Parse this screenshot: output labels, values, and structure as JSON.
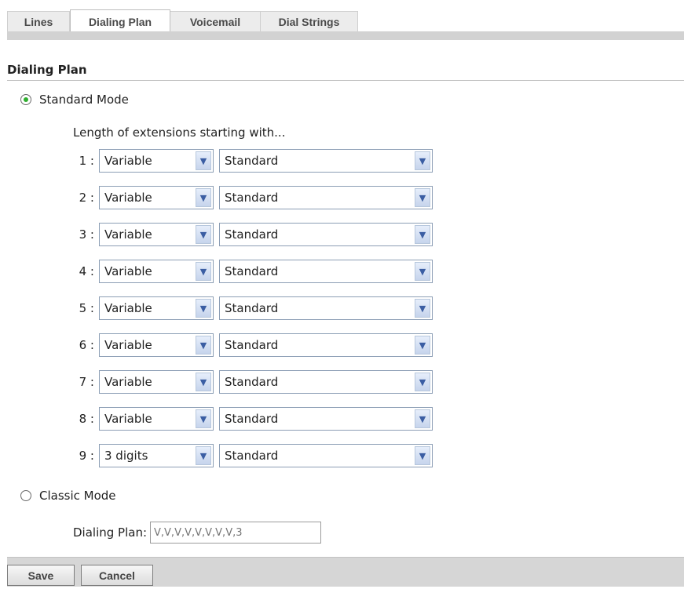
{
  "tabs": [
    {
      "label": "Lines",
      "active": false
    },
    {
      "label": "Dialing Plan",
      "active": true
    },
    {
      "label": "Voicemail",
      "active": false
    },
    {
      "label": "Dial Strings",
      "active": false
    }
  ],
  "section_title": "Dialing Plan",
  "standard_mode": {
    "label": "Standard Mode",
    "selected": true
  },
  "extensions_heading": "Length of extensions starting with...",
  "extensions": [
    {
      "num": "1 :",
      "length": "Variable",
      "mode": "Standard"
    },
    {
      "num": "2 :",
      "length": "Variable",
      "mode": "Standard"
    },
    {
      "num": "3 :",
      "length": "Variable",
      "mode": "Standard"
    },
    {
      "num": "4 :",
      "length": "Variable",
      "mode": "Standard"
    },
    {
      "num": "5 :",
      "length": "Variable",
      "mode": "Standard"
    },
    {
      "num": "6 :",
      "length": "Variable",
      "mode": "Standard"
    },
    {
      "num": "7 :",
      "length": "Variable",
      "mode": "Standard"
    },
    {
      "num": "8 :",
      "length": "Variable",
      "mode": "Standard"
    },
    {
      "num": "9 :",
      "length": "3 digits",
      "mode": "Standard"
    }
  ],
  "classic_mode": {
    "label": "Classic Mode",
    "selected": false
  },
  "dialing_plan_field": {
    "label": "Dialing Plan:",
    "placeholder": "V,V,V,V,V,V,V,V,3"
  },
  "buttons": {
    "save": "Save",
    "cancel": "Cancel"
  },
  "colors": {
    "radio_selected": "#2fae2f",
    "select_border": "#8c9eb5",
    "tab_strip": "#d2d2d2"
  },
  "icons": {
    "dropdown": "chevron-down-icon"
  }
}
